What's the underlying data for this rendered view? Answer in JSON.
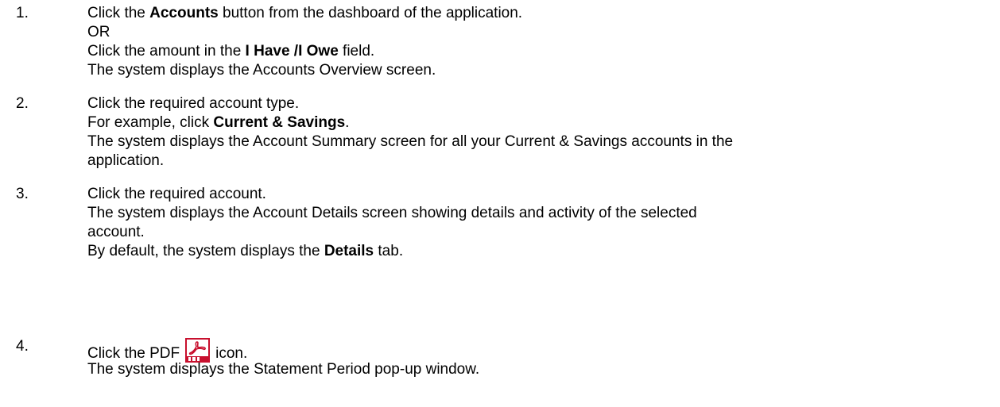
{
  "steps": [
    {
      "number": "1.",
      "lines": [
        {
          "pre": "Click the ",
          "bold": "Accounts",
          "post": " button from the dashboard of the application."
        },
        {
          "text": "OR"
        },
        {
          "pre": "Click the amount in the ",
          "bold": "I Have /I Owe",
          "post": " field."
        },
        {
          "text": "The system displays the Accounts Overview screen."
        }
      ]
    },
    {
      "number": "2.",
      "lines": [
        {
          "text": "Click the required account type."
        },
        {
          "pre": "For example, click ",
          "bold": "Current & Savings",
          "post": "."
        },
        {
          "text": "The system displays the Account Summary screen for all your Current & Savings accounts in the"
        },
        {
          "text": "application."
        }
      ]
    },
    {
      "number": "3.",
      "lines": [
        {
          "text": "Click the required account."
        },
        {
          "text": "The system displays the Account Details screen showing details and activity of the selected"
        },
        {
          "text": "account."
        },
        {
          "pre": "By default, the system displays the ",
          "bold": "Details",
          "post": " tab."
        }
      ]
    },
    {
      "number": "4.",
      "lines": [
        {
          "pre": "Click the PDF",
          "icon": "pdf-icon",
          "post": "icon."
        },
        {
          "text": "The system displays the Statement Period pop-up window."
        }
      ]
    }
  ],
  "colors": {
    "pdf_red": "#c8102e",
    "text": "#000000"
  }
}
